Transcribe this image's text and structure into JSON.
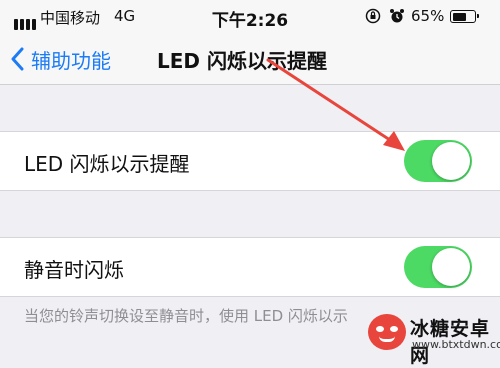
{
  "status_bar": {
    "carrier": "中国移动",
    "network": "4G",
    "time": "下午2:26",
    "battery_percent": "65%",
    "battery_level": 0.65,
    "icons": [
      "signal-icon",
      "rotation-lock-icon",
      "alarm-icon",
      "battery-icon"
    ]
  },
  "nav": {
    "back_label": "辅助功能",
    "title": "LED 闪烁以示提醒"
  },
  "settings": [
    {
      "label": "LED 闪烁以示提醒",
      "on": true
    },
    {
      "label": "静音时闪烁",
      "on": true
    }
  ],
  "footer_note": "当您的铃声切换设至静音时，使用 LED 闪烁以示",
  "colors": {
    "accent": "#1b7cf5",
    "toggle_on": "#4cd964",
    "background": "#efeff4",
    "annotation_arrow": "#e8453c"
  },
  "watermark": {
    "name": "冰糖安卓网",
    "url": "www.btxtdwn.com"
  }
}
